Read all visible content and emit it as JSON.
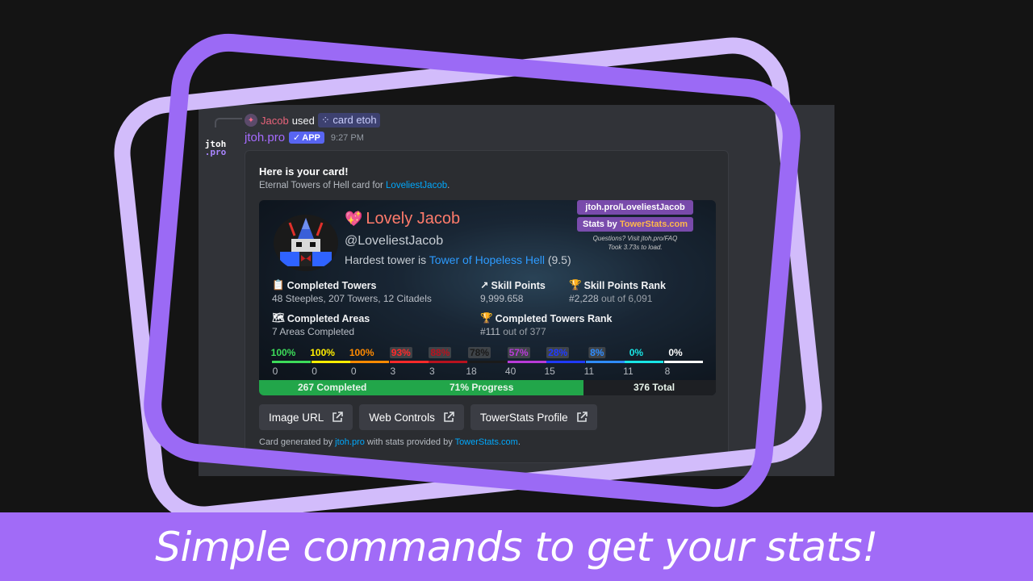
{
  "reply": {
    "user": "Jacob",
    "used_text": "used",
    "command": "card etoh"
  },
  "bot": {
    "avatar_line1": "jtoh",
    "avatar_line2": ".pro",
    "name": "jtoh.pro",
    "badge": "APP",
    "time": "9:27 PM"
  },
  "embed": {
    "title": "Here is your card!",
    "desc_prefix": "Eternal Towers of Hell card for ",
    "desc_user": "LoveliestJacob",
    "desc_suffix": "."
  },
  "card": {
    "display_name": "Lovely Jacob",
    "handle": "@LoveliestJacob",
    "hardest_prefix": "Hardest tower is ",
    "hardest_tower": "Tower of Hopeless Hell",
    "hardest_diff": "(9.5)",
    "link_url": "jtoh.pro/LoveliestJacob",
    "stats_by_prefix": "Stats by ",
    "stats_by_site": "TowerStats.com",
    "note_line1": "Questions? Visit jtoh.pro/FAQ",
    "note_line2": "Took 3.73s to load.",
    "completed_towers_label": "Completed Towers",
    "completed_towers_value": "48 Steeples, 207 Towers, 12 Citadels",
    "skill_points_label": "Skill Points",
    "skill_points_value": "9,999.658",
    "sp_rank_label": "Skill Points Rank",
    "sp_rank_value": "#2,228",
    "sp_rank_suffix": " out of 6,091",
    "completed_areas_label": "Completed Areas",
    "completed_areas_value": "7 Areas Completed",
    "ct_rank_label": "Completed Towers Rank",
    "ct_rank_value": "#111",
    "ct_rank_suffix": " out of 377",
    "difficulties": [
      {
        "pct": "100%",
        "count": "0",
        "color": "#3ddc5a"
      },
      {
        "pct": "100%",
        "count": "0",
        "color": "#ffee00"
      },
      {
        "pct": "100%",
        "count": "0",
        "color": "#ff8a00"
      },
      {
        "pct": "93%",
        "count": "3",
        "color": "#ff2a2a"
      },
      {
        "pct": "88%",
        "count": "3",
        "color": "#b8121e"
      },
      {
        "pct": "78%",
        "count": "18",
        "color": "#1a1a1a"
      },
      {
        "pct": "57%",
        "count": "40",
        "color": "#b93bd8"
      },
      {
        "pct": "28%",
        "count": "15",
        "color": "#1f3aff"
      },
      {
        "pct": "8%",
        "count": "11",
        "color": "#2f8cff"
      },
      {
        "pct": "0%",
        "count": "11",
        "color": "#19e6e6"
      },
      {
        "pct": "0%",
        "count": "8",
        "color": "#ffffff"
      }
    ],
    "progress_completed": "267 Completed",
    "progress_pct_text": "71% Progress",
    "progress_fraction": 0.71,
    "progress_total": "376 Total"
  },
  "buttons": {
    "image_url": "Image URL",
    "web_controls": "Web Controls",
    "towerstats_profile": "TowerStats Profile"
  },
  "footer": {
    "prefix": "Card generated by ",
    "link1": "jtoh.pro",
    "middle": " with stats provided by ",
    "link2": "TowerStats.com",
    "suffix": "."
  },
  "banner": {
    "text": "Simple commands to get your stats!"
  },
  "colors": {
    "frame_dark": "#9b6af5",
    "frame_light": "#d2bcfb",
    "banner_bg": "#a16bf7",
    "app_badge": "#5865f2",
    "link": "#00a8fc"
  }
}
